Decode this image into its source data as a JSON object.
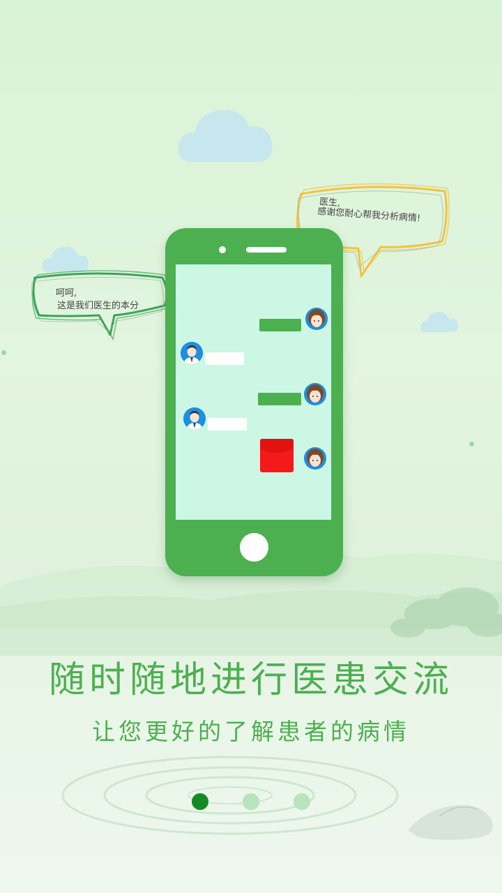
{
  "headline": "随时随地进行医患交流",
  "subline": "让您更好的了解患者的病情",
  "bubbles": {
    "doctor": {
      "line1": "呵呵,",
      "line2": "这是我们医生的本分"
    },
    "patient": {
      "line1": "医生,",
      "line2": "感谢您耐心帮我分析病情!"
    }
  },
  "pagination": {
    "count": 3,
    "active_index": 0
  },
  "colors": {
    "brand_green": "#4caf50",
    "dot_active": "#138a24",
    "dot_inactive": "#b7e4bd",
    "screen": "#ccf7e4",
    "red_packet": "#f41a1a"
  },
  "icons": [
    "cloud-icon",
    "doctor-avatar-icon",
    "patient-avatar-icon",
    "red-packet-icon"
  ]
}
